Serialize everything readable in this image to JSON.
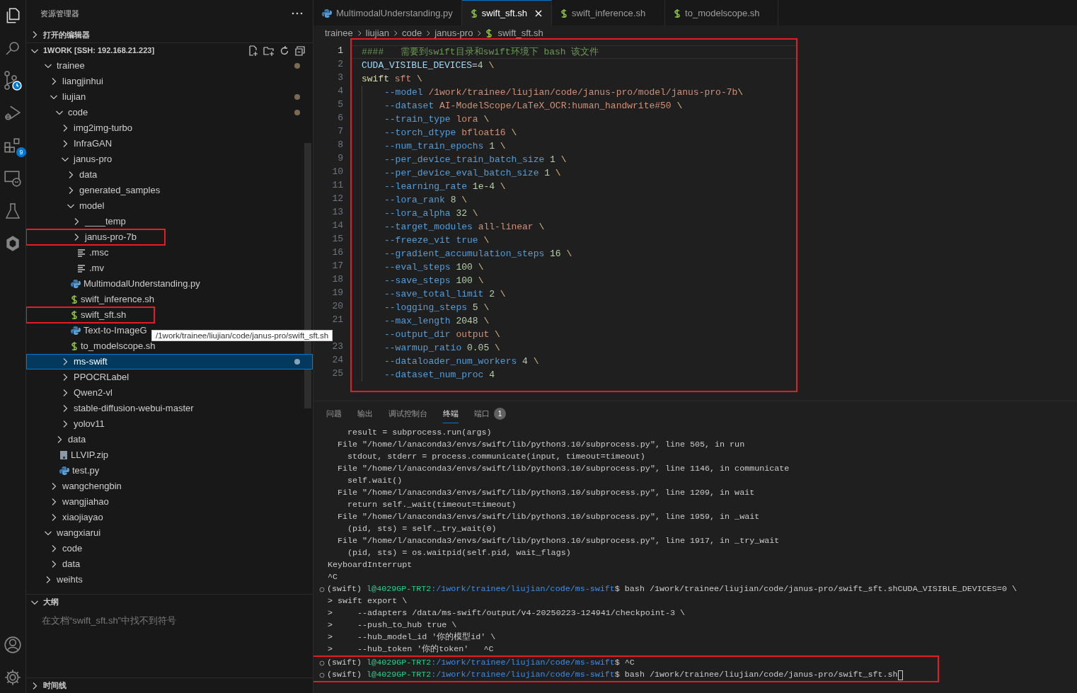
{
  "activity_bar": {
    "extensions_badge": "9"
  },
  "sidebar": {
    "title": "资源管理器",
    "sections": [
      {
        "kind": "open_editors",
        "title": "打开的编辑器",
        "expanded": false
      },
      {
        "kind": "folder",
        "title": "1WORK [SSH: 192.168.21.223]",
        "expanded": true,
        "tree": [
          {
            "name": "trainee",
            "kind": "folder",
            "expanded": true,
            "modified": true,
            "children": [
              {
                "name": "liangjinhui",
                "kind": "folder",
                "expanded": false
              },
              {
                "name": "liujian",
                "kind": "folder",
                "expanded": true,
                "modified": true,
                "children": [
                  {
                    "name": "code",
                    "kind": "folder",
                    "expanded": true,
                    "modified": true,
                    "children": [
                      {
                        "name": "img2img-turbo",
                        "kind": "folder",
                        "expanded": false
                      },
                      {
                        "name": "InfraGAN",
                        "kind": "folder",
                        "expanded": false
                      },
                      {
                        "name": "janus-pro",
                        "kind": "folder",
                        "expanded": true,
                        "children": [
                          {
                            "name": "data",
                            "kind": "folder",
                            "expanded": false
                          },
                          {
                            "name": "generated_samples",
                            "kind": "folder",
                            "expanded": false
                          },
                          {
                            "name": "model",
                            "kind": "folder",
                            "expanded": true,
                            "children": [
                              {
                                "name": "____temp",
                                "kind": "folder",
                                "expanded": false
                              },
                              {
                                "name": "janus-pro-7b",
                                "kind": "folder",
                                "expanded": false,
                                "highlighted": true
                              },
                              {
                                "name": ".msc",
                                "kind": "text_file"
                              },
                              {
                                "name": ".mv",
                                "kind": "text_file"
                              }
                            ]
                          },
                          {
                            "name": "MultimodalUnderstanding.py",
                            "kind": "py_file"
                          },
                          {
                            "name": "swift_inference.sh",
                            "kind": "sh_file"
                          },
                          {
                            "name": "swift_sft.sh",
                            "kind": "sh_file",
                            "highlighted": true
                          },
                          {
                            "name": "Text-to-ImageG",
                            "kind": "py_file"
                          },
                          {
                            "name": "to_modelscope.sh",
                            "kind": "sh_file"
                          }
                        ]
                      },
                      {
                        "name": "ms-swift",
                        "kind": "folder",
                        "expanded": false,
                        "modified": true,
                        "selected": true
                      },
                      {
                        "name": "PPOCRLabel",
                        "kind": "folder",
                        "expanded": false
                      },
                      {
                        "name": "Qwen2-vl",
                        "kind": "folder",
                        "expanded": false
                      },
                      {
                        "name": "stable-diffusion-webui-master",
                        "kind": "folder",
                        "expanded": false
                      },
                      {
                        "name": "yolov11",
                        "kind": "folder",
                        "expanded": false
                      }
                    ]
                  },
                  {
                    "name": "data",
                    "kind": "folder",
                    "expanded": false
                  },
                  {
                    "name": "LLVIP.zip",
                    "kind": "zip_file"
                  },
                  {
                    "name": "test.py",
                    "kind": "py_file"
                  }
                ]
              },
              {
                "name": "wangchengbin",
                "kind": "folder",
                "expanded": false
              },
              {
                "name": "wangjiahao",
                "kind": "folder",
                "expanded": false
              },
              {
                "name": "xiaojiayao",
                "kind": "folder",
                "expanded": false
              }
            ]
          },
          {
            "name": "wangxiarui",
            "kind": "folder",
            "expanded": true,
            "children": [
              {
                "name": "code",
                "kind": "folder",
                "expanded": false
              },
              {
                "name": "data",
                "kind": "folder",
                "expanded": false
              }
            ]
          },
          {
            "name": "weihts",
            "kind": "folder",
            "expanded": false
          }
        ]
      },
      {
        "kind": "outline",
        "title": "大纲",
        "expanded": true,
        "message": "在文档“swift_sft.sh”中找不到符号"
      },
      {
        "kind": "timeline",
        "title": "时间线",
        "expanded": false
      }
    ]
  },
  "tooltip": "/1work/trainee/liujian/code/janus-pro/swift_sft.sh",
  "editor": {
    "tabs": [
      {
        "label": "MultimodalUnderstanding.py",
        "kind": "py_file",
        "selected": false
      },
      {
        "label": "swift_sft.sh",
        "kind": "sh_file",
        "selected": true
      },
      {
        "label": "swift_inference.sh",
        "kind": "sh_file",
        "selected": false
      },
      {
        "label": "to_modelscope.sh",
        "kind": "sh_file",
        "selected": false
      }
    ],
    "breadcrumb": [
      {
        "label": "trainee",
        "kind": "folder"
      },
      {
        "label": "liujian",
        "kind": "folder"
      },
      {
        "label": "code",
        "kind": "folder"
      },
      {
        "label": "janus-pro",
        "kind": "folder"
      },
      {
        "label": "swift_sft.sh",
        "kind": "sh_file"
      }
    ],
    "highlighted": true,
    "lines": [
      {
        "number": "1",
        "indented": false,
        "current": true,
        "segments": [
          {
            "text": "####   需要到swift目录和swift环境下 bash 该文件",
            "kind": "comment"
          }
        ]
      },
      {
        "number": "2",
        "indented": false,
        "segments": [
          {
            "text": "CUDA_VISIBLE_DEVICES",
            "kind": "var"
          },
          {
            "text": "=",
            "kind": "plain"
          },
          {
            "text": "4",
            "kind": "num"
          },
          {
            "text": " \\",
            "kind": "esc"
          }
        ]
      },
      {
        "number": "3",
        "indented": false,
        "segments": [
          {
            "text": "swift",
            "kind": "cmd"
          },
          {
            "text": " sft",
            "kind": "str"
          },
          {
            "text": " \\",
            "kind": "esc"
          }
        ]
      },
      {
        "number": "4",
        "indented": true,
        "segments": [
          {
            "text": "--model",
            "kind": "opt"
          },
          {
            "text": " /1work/trainee/liujian/code/janus-pro/model/janus-pro-7b",
            "kind": "str"
          },
          {
            "text": "\\",
            "kind": "esc"
          }
        ]
      },
      {
        "number": "5",
        "indented": true,
        "segments": [
          {
            "text": "--dataset",
            "kind": "opt"
          },
          {
            "text": " AI-ModelScope/LaTeX_OCR:human_handwrite#50",
            "kind": "str"
          },
          {
            "text": " \\",
            "kind": "esc"
          }
        ]
      },
      {
        "number": "6",
        "indented": true,
        "segments": [
          {
            "text": "--train_type",
            "kind": "opt"
          },
          {
            "text": " lora",
            "kind": "str"
          },
          {
            "text": " \\",
            "kind": "esc"
          }
        ]
      },
      {
        "number": "7",
        "indented": true,
        "segments": [
          {
            "text": "--torch_dtype",
            "kind": "opt"
          },
          {
            "text": " bfloat16",
            "kind": "str"
          },
          {
            "text": " \\",
            "kind": "esc"
          }
        ]
      },
      {
        "number": "8",
        "indented": true,
        "segments": [
          {
            "text": "--num_train_epochs",
            "kind": "opt"
          },
          {
            "text": " 1",
            "kind": "num"
          },
          {
            "text": " \\",
            "kind": "esc"
          }
        ]
      },
      {
        "number": "9",
        "indented": true,
        "segments": [
          {
            "text": "--per_device_train_batch_size",
            "kind": "opt"
          },
          {
            "text": " 1",
            "kind": "num"
          },
          {
            "text": " \\",
            "kind": "esc"
          }
        ]
      },
      {
        "number": "10",
        "indented": true,
        "segments": [
          {
            "text": "--per_device_eval_batch_size",
            "kind": "opt"
          },
          {
            "text": " 1",
            "kind": "num"
          },
          {
            "text": " \\",
            "kind": "esc"
          }
        ]
      },
      {
        "number": "11",
        "indented": true,
        "segments": [
          {
            "text": "--learning_rate",
            "kind": "opt"
          },
          {
            "text": " 1e-4",
            "kind": "num"
          },
          {
            "text": " \\",
            "kind": "esc"
          }
        ]
      },
      {
        "number": "12",
        "indented": true,
        "segments": [
          {
            "text": "--lora_rank",
            "kind": "opt"
          },
          {
            "text": " 8",
            "kind": "num"
          },
          {
            "text": " \\",
            "kind": "esc"
          }
        ]
      },
      {
        "number": "13",
        "indented": true,
        "segments": [
          {
            "text": "--lora_alpha",
            "kind": "opt"
          },
          {
            "text": " 32",
            "kind": "num"
          },
          {
            "text": " \\",
            "kind": "esc"
          }
        ]
      },
      {
        "number": "14",
        "indented": true,
        "segments": [
          {
            "text": "--target_modules",
            "kind": "opt"
          },
          {
            "text": " all-linear",
            "kind": "str"
          },
          {
            "text": " \\",
            "kind": "esc"
          }
        ]
      },
      {
        "number": "15",
        "indented": true,
        "segments": [
          {
            "text": "--freeze_vit",
            "kind": "opt"
          },
          {
            "text": " true",
            "kind": "opt"
          },
          {
            "text": " \\",
            "kind": "esc"
          }
        ]
      },
      {
        "number": "16",
        "indented": true,
        "segments": [
          {
            "text": "--gradient_accumulation_steps",
            "kind": "opt"
          },
          {
            "text": " 16",
            "kind": "num"
          },
          {
            "text": " \\",
            "kind": "esc"
          }
        ]
      },
      {
        "number": "17",
        "indented": true,
        "segments": [
          {
            "text": "--eval_steps",
            "kind": "opt"
          },
          {
            "text": " 100",
            "kind": "num"
          },
          {
            "text": " \\",
            "kind": "esc"
          }
        ]
      },
      {
        "number": "18",
        "indented": true,
        "segments": [
          {
            "text": "--save_steps",
            "kind": "opt"
          },
          {
            "text": " 100",
            "kind": "num"
          },
          {
            "text": " \\",
            "kind": "esc"
          }
        ]
      },
      {
        "number": "19",
        "indented": true,
        "segments": [
          {
            "text": "--save_total_limit",
            "kind": "opt"
          },
          {
            "text": " 2",
            "kind": "num"
          },
          {
            "text": " \\",
            "kind": "esc"
          }
        ]
      },
      {
        "number": "20",
        "indented": true,
        "segments": [
          {
            "text": "--logging_steps",
            "kind": "opt"
          },
          {
            "text": " 5",
            "kind": "num"
          },
          {
            "text": " \\",
            "kind": "esc"
          }
        ]
      },
      {
        "number": "21",
        "indented": true,
        "segments": [
          {
            "text": "--max_length",
            "kind": "opt"
          },
          {
            "text": " 2048",
            "kind": "num"
          },
          {
            "text": " \\",
            "kind": "esc"
          }
        ]
      },
      {
        "indented": true,
        "segments": [
          {
            "text": "--output_dir",
            "kind": "opt"
          },
          {
            "text": " output",
            "kind": "str"
          },
          {
            "text": " \\",
            "kind": "esc"
          }
        ]
      },
      {
        "number": "23",
        "indented": true,
        "segments": [
          {
            "text": "--warmup_ratio",
            "kind": "opt"
          },
          {
            "text": " 0.05",
            "kind": "num"
          },
          {
            "text": " \\",
            "kind": "esc"
          }
        ]
      },
      {
        "number": "24",
        "indented": true,
        "segments": [
          {
            "text": "--dataloader_num_workers",
            "kind": "opt"
          },
          {
            "text": " 4",
            "kind": "num"
          },
          {
            "text": " \\",
            "kind": "esc"
          }
        ]
      },
      {
        "number": "25",
        "indented": true,
        "segments": [
          {
            "text": "--dataset_num_proc",
            "kind": "opt"
          },
          {
            "text": " 4",
            "kind": "num"
          }
        ]
      }
    ]
  },
  "panel": {
    "tabs": [
      {
        "label": "问题",
        "selected": false
      },
      {
        "label": "输出",
        "selected": false
      },
      {
        "label": "调试控制台",
        "selected": false
      },
      {
        "label": "终端",
        "selected": true
      },
      {
        "label": "端口",
        "selected": false,
        "badge": "1"
      }
    ],
    "terminal": [
      {
        "kind": "text",
        "text": "    result = subprocess.run(args)"
      },
      {
        "kind": "text",
        "text": "  File \"/home/l/anaconda3/envs/swift/lib/python3.10/subprocess.py\", line 505, in run"
      },
      {
        "kind": "text",
        "text": "    stdout, stderr = process.communicate(input, timeout=timeout)"
      },
      {
        "kind": "text",
        "text": "  File \"/home/l/anaconda3/envs/swift/lib/python3.10/subprocess.py\", line 1146, in communicate"
      },
      {
        "kind": "text",
        "text": "    self.wait()"
      },
      {
        "kind": "text",
        "text": "  File \"/home/l/anaconda3/envs/swift/lib/python3.10/subprocess.py\", line 1209, in wait"
      },
      {
        "kind": "text",
        "text": "    return self._wait(timeout=timeout)"
      },
      {
        "kind": "text",
        "text": "  File \"/home/l/anaconda3/envs/swift/lib/python3.10/subprocess.py\", line 1959, in _wait"
      },
      {
        "kind": "text",
        "text": "    (pid, sts) = self._try_wait(0)"
      },
      {
        "kind": "text",
        "text": "  File \"/home/l/anaconda3/envs/swift/lib/python3.10/subprocess.py\", line 1917, in _try_wait"
      },
      {
        "kind": "text",
        "text": "    (pid, sts) = os.waitpid(self.pid, wait_flags)"
      },
      {
        "kind": "text",
        "text": "KeyboardInterrupt"
      },
      {
        "kind": "text",
        "text": "^C"
      },
      {
        "kind": "prompt",
        "env": "(swift) ",
        "user": "l@4029GP-TRT2",
        "path": ":/1work/trainee/liujian/code/ms-swift",
        "command": "$ bash /1work/trainee/liujian/code/janus-pro/swift_sft.shCUDA_VISIBLE_DEVICES=0 \\"
      },
      {
        "kind": "text",
        "text": "> swift export \\"
      },
      {
        "kind": "text",
        "text": ">     --adapters /data/ms-swift/output/v4-20250223-124941/checkpoint-3 \\"
      },
      {
        "kind": "text",
        "text": ">     --push_to_hub true \\"
      },
      {
        "kind": "text",
        "text": ">     --hub_model_id '你的模型id' \\"
      },
      {
        "kind": "text",
        "text": ">     --hub_token '你的token'   ^C"
      },
      {
        "kind": "prompt",
        "env": "(swift) ",
        "user": "l@4029GP-TRT2",
        "path": ":/1work/trainee/liujian/code/ms-swift",
        "command": "$ ^C",
        "highlighted": true
      },
      {
        "kind": "prompt",
        "env": "(swift) ",
        "user": "l@4029GP-TRT2",
        "path": ":/1work/trainee/liujian/code/ms-swift",
        "command": "$ bash /1work/trainee/liujian/code/janus-pro/swift_sft.sh",
        "cursor": true,
        "highlighted": true
      }
    ]
  }
}
